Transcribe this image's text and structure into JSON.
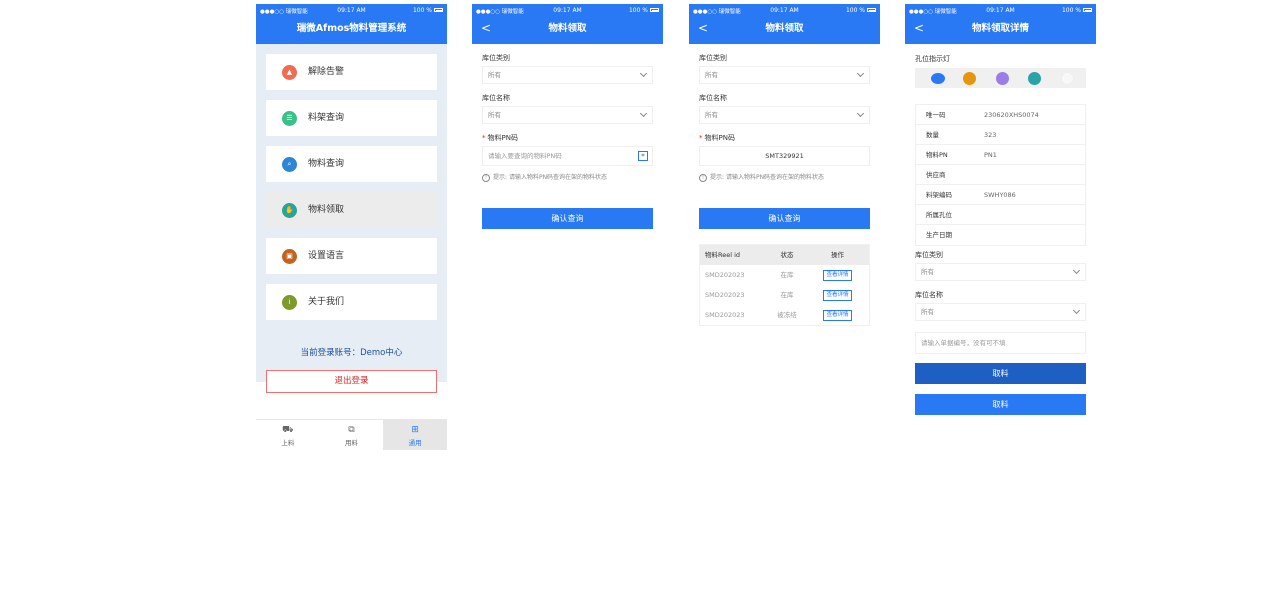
{
  "status_bar": {
    "carrier": "●●●○○ 瑞微智能",
    "time": "09:17 AM",
    "battery": "100 %"
  },
  "screen1": {
    "title": "瑞微Afmos物料管理系统",
    "menu": [
      {
        "label": "解除告警",
        "icon": "alarm-icon",
        "color": "#f26a4f"
      },
      {
        "label": "料架查询",
        "icon": "rack-icon",
        "color": "#3cc08a"
      },
      {
        "label": "物料查询",
        "icon": "search-doc-icon",
        "color": "#2b86d8"
      },
      {
        "label": "物料领取",
        "icon": "hand-receive-icon",
        "color": "#2aa39a"
      },
      {
        "label": "设置语言",
        "icon": "language-icon",
        "color": "#c2631f"
      },
      {
        "label": "关于我们",
        "icon": "info-icon",
        "color": "#7e9a2b"
      }
    ],
    "account_text": "当前登录账号：Demo中心",
    "logout_label": "退出登录",
    "tabs": [
      {
        "label": "上料",
        "icon": "cart-icon"
      },
      {
        "label": "用料",
        "icon": "boxes-icon"
      },
      {
        "label": "通用",
        "icon": "grid-icon"
      }
    ]
  },
  "screen2": {
    "title": "物料领取",
    "warehouse_type_label": "库位类别",
    "warehouse_type_value": "所有",
    "warehouse_name_label": "库位名称",
    "warehouse_name_value": "所有",
    "pn_label": "物料PN码",
    "pn_placeholder": "请输入要查询的物料PN码",
    "tip_prefix": "提示:",
    "tip_text": "请输入物料PN码查询在架的物料状态",
    "confirm_label": "确认查询"
  },
  "screen3": {
    "title": "物料领取",
    "warehouse_type_label": "库位类别",
    "warehouse_type_value": "所有",
    "warehouse_name_label": "库位名称",
    "warehouse_name_value": "所有",
    "pn_label": "物料PN码",
    "pn_value": "SMT329921",
    "tip_prefix": "提示:",
    "tip_text": "请输入物料PN码查询在架的物料状态",
    "confirm_label": "确认查询",
    "table": {
      "headers": [
        "物料Reel id",
        "状态",
        "操作"
      ],
      "rows": [
        {
          "reel_id": "SMD202023",
          "status": "在库",
          "action": "查看详情"
        },
        {
          "reel_id": "SMD202023",
          "status": "在库",
          "action": "查看详情"
        },
        {
          "reel_id": "SMD202023",
          "status": "被冻结",
          "action": "查看详情"
        }
      ]
    }
  },
  "screen4": {
    "title": "物料领取详情",
    "position_light_label": "孔位指示灯",
    "lights": [
      "#2979f5",
      "#e8940c",
      "#9b7de6",
      "#2aa3a6",
      "#f4f4f4"
    ],
    "info": [
      {
        "key": "唯一码",
        "value": "230620XHS0074"
      },
      {
        "key": "数量",
        "value": "323"
      },
      {
        "key": "物料PN",
        "value": "PN1"
      },
      {
        "key": "供应商",
        "value": ""
      },
      {
        "key": "料架编码",
        "value": "SWHY086"
      },
      {
        "key": "所属孔位",
        "value": ""
      },
      {
        "key": "生产日期",
        "value": ""
      }
    ],
    "warehouse_type_label": "库位类别",
    "warehouse_type_value": "所有",
    "warehouse_name_label": "库位名称",
    "warehouse_name_value": "所有",
    "order_placeholder": "请输入单据编号，没有可不填",
    "take_label_1": "取料",
    "take_label_2": "取料"
  }
}
